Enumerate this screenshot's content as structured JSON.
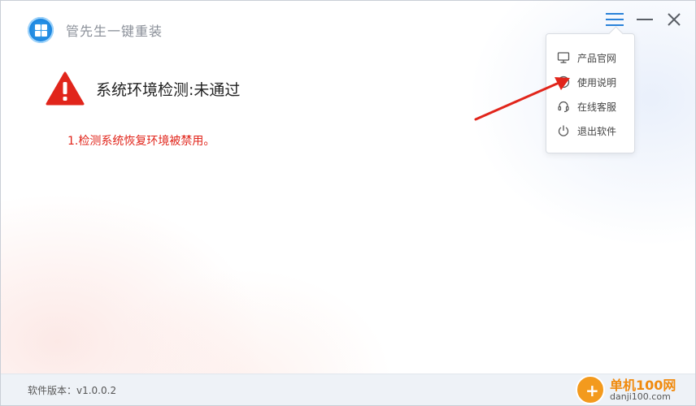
{
  "app": {
    "title": "管先生一键重装"
  },
  "window_controls": {
    "menu": "menu-icon",
    "minimize": "minimize-icon",
    "close": "close-icon"
  },
  "check": {
    "headline": "系统环境检测:未通过",
    "errors": [
      "1.检测系统恢复环境被禁用。"
    ],
    "status_color": "#e1251b"
  },
  "menu": {
    "items": [
      {
        "label": "产品官网",
        "icon": "monitor-icon"
      },
      {
        "label": "使用说明",
        "icon": "help-icon"
      },
      {
        "label": "在线客服",
        "icon": "headset-icon"
      },
      {
        "label": "退出软件",
        "icon": "power-icon"
      }
    ]
  },
  "footer": {
    "version": "软件版本：v1.0.0.2"
  },
  "watermark": {
    "name": "单机100网",
    "url": "danji100.com"
  },
  "colors": {
    "accent": "#2a82d9",
    "warning": "#e1251b"
  }
}
